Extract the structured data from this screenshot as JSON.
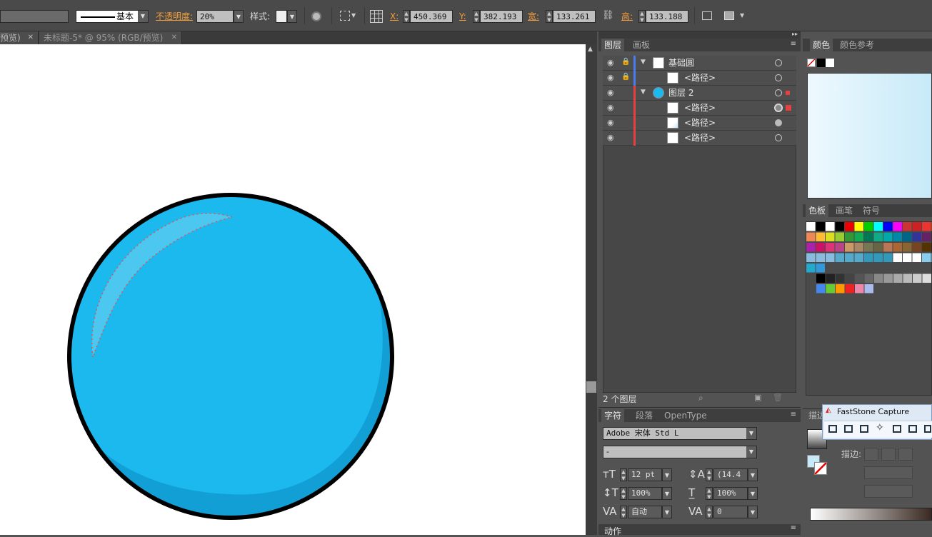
{
  "control_bar": {
    "stroke_style": "基本",
    "opacity_label": "不透明度:",
    "opacity_value": "20%",
    "style_label": "样式:",
    "x_label": "X:",
    "x_value": "450.369",
    "y_label": "Y:",
    "y_value": "382.193",
    "w_label": "宽:",
    "w_value": "133.261",
    "h_label": "高:",
    "h_value": "133.188"
  },
  "doc_tabs": [
    {
      "label": "预览)"
    },
    {
      "label": "未标题-5* @ 95% (RGB/预览)"
    }
  ],
  "layers_panel": {
    "tabs": [
      "图层",
      "画板"
    ],
    "rows": [
      {
        "name": "基础圆",
        "bar": "#4a7cf0"
      },
      {
        "name": "<路径>",
        "bar": "#4a7cf0"
      },
      {
        "name": "图层 2",
        "bar": "#e84040"
      },
      {
        "name": "<路径>",
        "bar": "#e84040"
      },
      {
        "name": "<路径>",
        "bar": "#e84040"
      },
      {
        "name": "<路径>",
        "bar": "#e84040"
      }
    ],
    "footer_count": "2 个图层"
  },
  "color_panel": {
    "tabs": [
      "颜色",
      "颜色参考"
    ]
  },
  "swatches_panel": {
    "tabs": [
      "色板",
      "画笔",
      "符号"
    ]
  },
  "character_panel": {
    "tabs": [
      "字符",
      "段落",
      "OpenType"
    ],
    "font_family": "Adobe 宋体 Std L",
    "font_style": "-",
    "font_size": "12 pt",
    "leading": "(14.4",
    "vscale": "100%",
    "hscale": "100%",
    "kerning": "自动",
    "tracking": "0"
  },
  "stroke_panel": {
    "tab": "描边",
    "stroke_label": "描边:"
  },
  "actions_panel": {
    "tab": "动作"
  },
  "faststone": {
    "title": "FastStone Capture"
  },
  "colors": {
    "sphere": "#1bb9ee",
    "sphere_shadow": "#119fd6",
    "outline": "#000000",
    "selection": "#f04e4e"
  }
}
